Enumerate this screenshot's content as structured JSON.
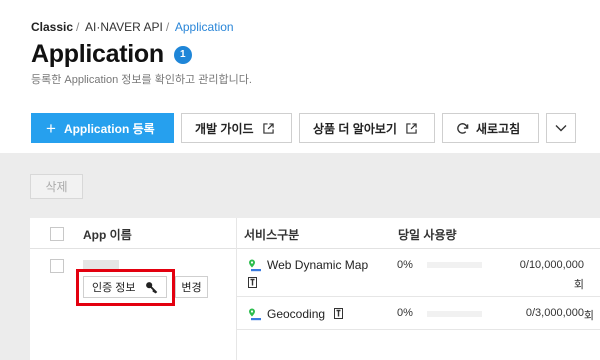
{
  "breadcrumb": {
    "items": [
      "Classic",
      "AI·NAVER API",
      "Application"
    ],
    "separator": "/"
  },
  "header": {
    "title": "Application",
    "badge": "1",
    "subtitle": "등록한 Application 정보를 확인하고 관리합니다."
  },
  "toolbar": {
    "register_label": "Application 등록",
    "guide_label": "개발 가이드",
    "product_label": "상품 더 알아보기",
    "refresh_label": "새로고침"
  },
  "actions": {
    "delete_label": "삭제"
  },
  "table": {
    "headers": {
      "app_name": "App 이름",
      "service": "서비스구분",
      "daily_usage": "당일 사용량"
    },
    "rows": [
      {
        "auth_label": "인증 정보",
        "change_label": "변경",
        "services": [
          {
            "name": "Web Dynamic Map",
            "percent": "0%",
            "usage": "0/10,000,000",
            "unit": "회",
            "fill": 0
          },
          {
            "name": "Geocoding",
            "percent": "0%",
            "usage": "0/3,000,000",
            "unit": "회",
            "fill": 0
          }
        ]
      }
    ]
  },
  "colors": {
    "accent": "#26a0ee",
    "badge": "#1f86d8",
    "highlight": "#e3000f",
    "link": "#2a86d8",
    "content_bg": "#ececec"
  },
  "icons": [
    "plus-icon",
    "external-link-icon",
    "refresh-icon",
    "chevron-down-icon",
    "map-pin-icon",
    "document-icon",
    "key-icon"
  ]
}
